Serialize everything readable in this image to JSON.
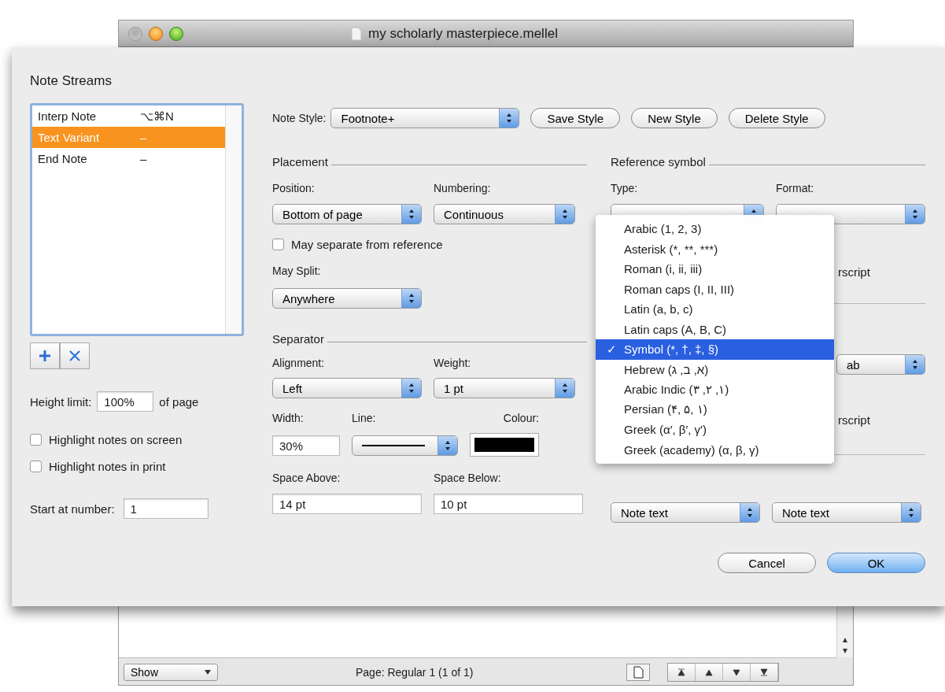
{
  "window": {
    "title": "my scholarly masterpiece.mellel"
  },
  "sheet": {
    "title": "Note Streams"
  },
  "streams": [
    {
      "name": "Interp Note",
      "shortcut": "⌥⌘N",
      "selected": false
    },
    {
      "name": "Text Variant",
      "shortcut": "–",
      "selected": true
    },
    {
      "name": "End Note",
      "shortcut": "–",
      "selected": false
    }
  ],
  "list_buttons": [
    {
      "kind": "add"
    },
    {
      "kind": "remove"
    }
  ],
  "height_limit": {
    "label": "Height limit:",
    "value": "100%",
    "suffix": "of page"
  },
  "options": [
    {
      "label": "Highlight notes on screen",
      "checked": false
    },
    {
      "label": "Highlight notes in print",
      "checked": false
    }
  ],
  "start_number": {
    "label": "Start at number:",
    "value": "1"
  },
  "note_style": {
    "label": "Note Style:",
    "value": "Footnote+"
  },
  "style_buttons": [
    "Save Style",
    "New Style",
    "Delete Style"
  ],
  "placement": {
    "header": "Placement",
    "position": {
      "label": "Position:",
      "value": "Bottom of page"
    },
    "numbering": {
      "label": "Numbering:",
      "value": "Continuous"
    },
    "separate": {
      "label": "May separate from reference",
      "checked": false
    },
    "may_split": {
      "label": "May Split:",
      "value": "Anywhere"
    }
  },
  "separator": {
    "header": "Separator",
    "alignment": {
      "label": "Alignment:",
      "value": "Left"
    },
    "weight": {
      "label": "Weight:",
      "value": "1 pt"
    },
    "width": {
      "label": "Width:",
      "value": "30%"
    },
    "line": {
      "label": "Line:"
    },
    "colour": {
      "label": "Colour:",
      "color": "#000000"
    },
    "space_above": {
      "label": "Space Above:",
      "value": "14 pt"
    },
    "space_below": {
      "label": "Space Below:",
      "value": "10 pt"
    }
  },
  "reference_symbol": {
    "header": "Reference symbol",
    "type": {
      "label": "Type:"
    },
    "format": {
      "label": "Format:"
    },
    "partial_text_1": "rscript",
    "partial_popup": "ab",
    "partial_text_2": "rscript",
    "paragraph_popup": "Note text",
    "character_popup": "Note text"
  },
  "type_menu": [
    {
      "label": "Arabic (1, 2, 3)",
      "selected": false
    },
    {
      "label": "Asterisk (*, **, ***)",
      "selected": false
    },
    {
      "label": "Roman (i, ii, iii)",
      "selected": false
    },
    {
      "label": "Roman caps (I, II, III)",
      "selected": false
    },
    {
      "label": "Latin (a, b, c)",
      "selected": false
    },
    {
      "label": "Latin caps (A, B, C)",
      "selected": false
    },
    {
      "label": "Symbol (*, †, ‡, §)",
      "selected": true
    },
    {
      "label": "Hebrew (א, ב, ג)",
      "selected": false
    },
    {
      "label": "Arabic Indic (١, ٢, ٣)",
      "selected": false
    },
    {
      "label": "Persian (۴, ۵, ۱)",
      "selected": false
    },
    {
      "label": "Greek (α′, β′, γ′)",
      "selected": false
    },
    {
      "label": "Greek (academy) (α, β, γ)",
      "selected": false
    }
  ],
  "check_mark": "✓",
  "dialog_buttons": [
    {
      "label": "Cancel",
      "kind": "normal"
    },
    {
      "label": "OK",
      "kind": "default"
    }
  ],
  "document": {
    "show": "Show",
    "page_info": "Page: Regular 1 (1 of 1)"
  }
}
